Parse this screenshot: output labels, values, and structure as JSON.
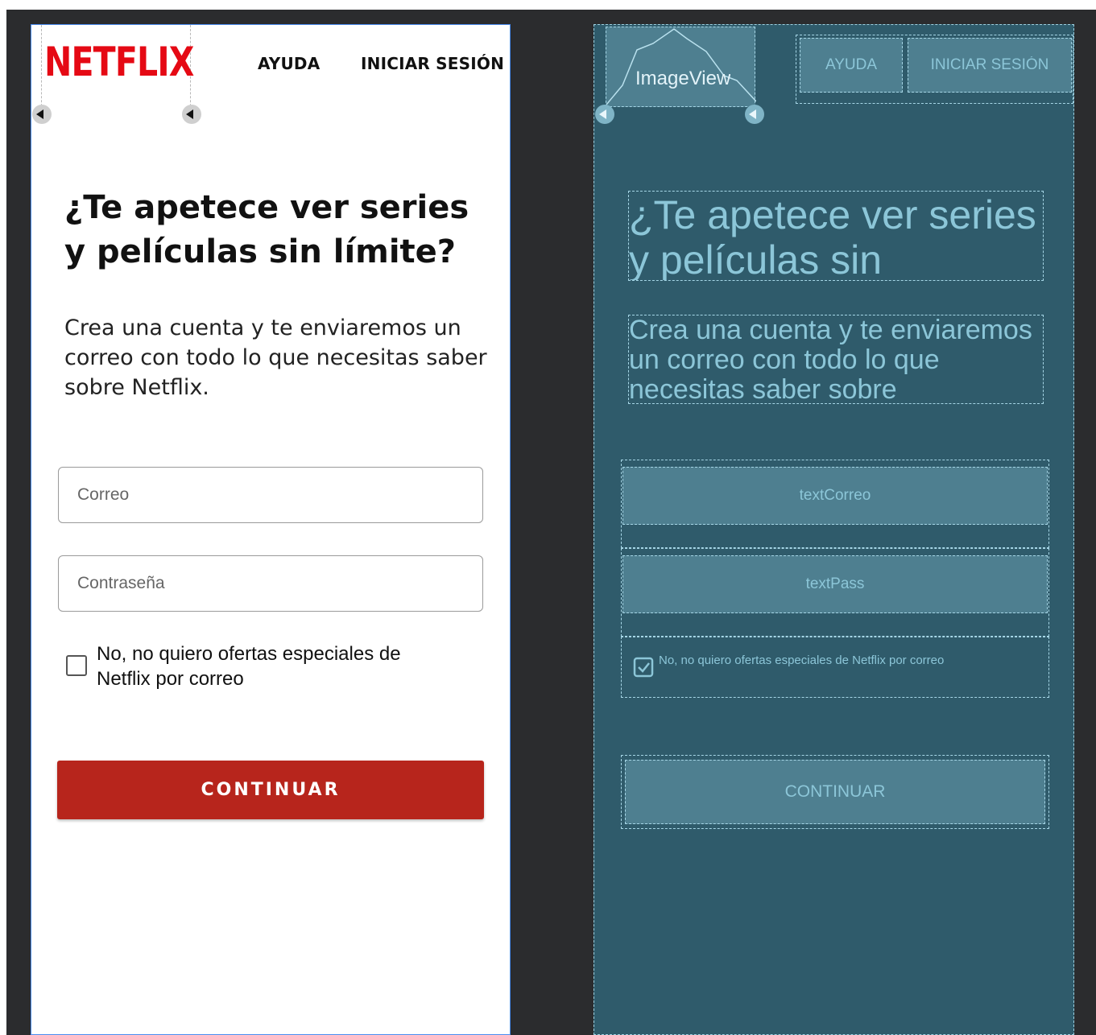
{
  "design": {
    "logo": "NETFLIX",
    "nav": {
      "help": "AYUDA",
      "login": "INICIAR SESIÓN"
    },
    "headline": "¿Te apetece ver series y películas sin límite?",
    "subtext": "Crea una cuenta y te enviaremos un correo con todo lo que necesitas saber sobre Netflix.",
    "email_placeholder": "Correo",
    "password_placeholder": "Contraseña",
    "checkbox_label": "No, no quiero ofertas especiales de Netflix por correo",
    "checkbox_checked": false,
    "continue_label": "CONTINUAR"
  },
  "blueprint": {
    "image_label": "ImageView",
    "help": "AYUDA",
    "login": "INICIAR SESIÓN",
    "headline": "¿Te apetece ver series y películas sin",
    "subtext": "Crea una cuenta y te enviaremos un correo con todo lo que necesitas saber sobre",
    "email_id": "textCorreo",
    "password_id": "textPass",
    "checkbox_label": "No, no quiero ofertas especiales de Netflix por correo",
    "continue_label": "CONTINUAR"
  },
  "colors": {
    "brand": "#e50914",
    "button": "#b7251c",
    "blueprint_bg": "#2f5b6b",
    "canvas_bg": "#2b2c2e"
  }
}
